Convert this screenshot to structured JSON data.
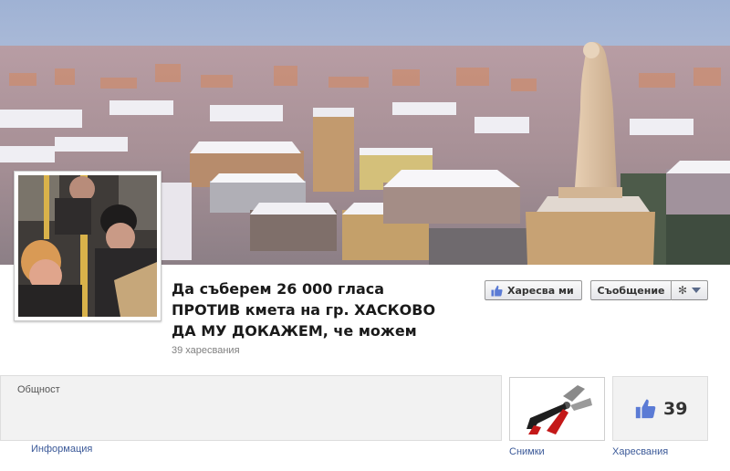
{
  "page": {
    "title_lines": [
      "Да съберем 26 000 гласа",
      "ПРОТИВ кмета на гр. ХАСКОВО",
      "ДА МУ ДОКАЖЕМ, че можем"
    ],
    "likes_text": "39 харесвания"
  },
  "actions": {
    "like_label": "Харесва ми",
    "message_label": "Съобщение",
    "settings_icon": "gear-icon"
  },
  "about": {
    "category": "Общност",
    "link_label": "Информация"
  },
  "tiles": {
    "photos_label": "Снимки",
    "likes_label": "Харесвания",
    "likes_count": "39"
  },
  "colors": {
    "link": "#3b5998",
    "tile_background": "#f2f2f2",
    "like_thumb": "#5b7bd5"
  }
}
